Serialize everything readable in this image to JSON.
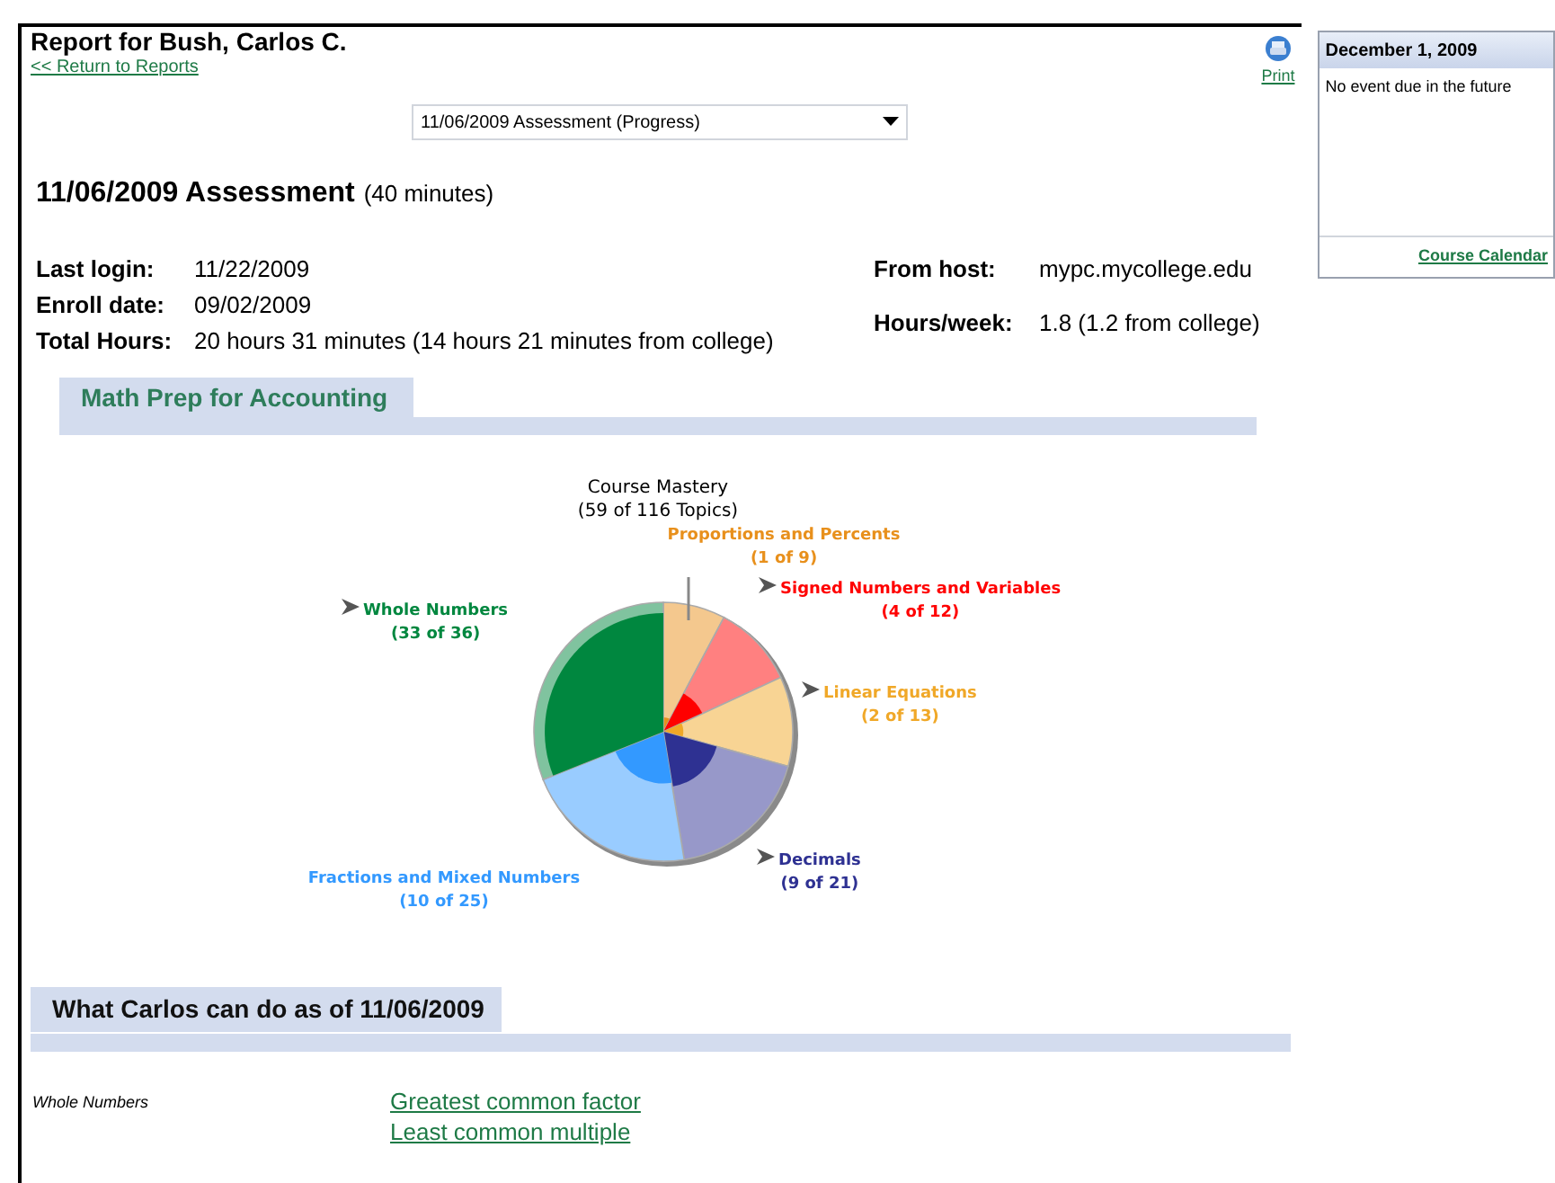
{
  "header": {
    "title": "Report for Bush, Carlos C.",
    "back_link": "<< Return to Reports",
    "print_link": "Print"
  },
  "assessment_select": {
    "value": "11/06/2009 Assessment (Progress)"
  },
  "assessment": {
    "title": "11/06/2009 Assessment",
    "duration": "(40 minutes)"
  },
  "info_left": [
    {
      "label": "Last login:",
      "value": "11/22/2009"
    },
    {
      "label": "Enroll date:",
      "value": "09/02/2009"
    },
    {
      "label": "Total Hours:",
      "value": "20 hours 31 minutes (14 hours 21 minutes from college)"
    }
  ],
  "info_right": [
    {
      "label": "From host:",
      "value": "mypc.mycollege.edu"
    },
    {
      "label": "Hours/week:",
      "value": "1.8 (1.2 from college)"
    }
  ],
  "course_section": {
    "title": "Math Prep for Accounting",
    "mastery_chart": {
      "title": "Course Mastery",
      "subtitle": "(59 of 116 Topics)",
      "topics": [
        {
          "name": "Proportions and Percents",
          "score": "(1 of 9)",
          "color": "#e8901c",
          "pointer": false
        },
        {
          "name": "Signed Numbers and Variables",
          "score": "(4 of 12)",
          "color": "#ff0000",
          "pointer": true
        },
        {
          "name": "Whole Numbers",
          "score": "(33 of 36)",
          "color": "#00873f",
          "pointer": true
        },
        {
          "name": "Linear Equations",
          "score": "(2 of 13)",
          "color": "#f0a828",
          "pointer": true
        },
        {
          "name": "Decimals",
          "score": "(9 of 21)",
          "color": "#2e3192",
          "pointer": true
        },
        {
          "name": "Fractions and Mixed Numbers",
          "score": "(10 of 25)",
          "color": "#3399ff",
          "pointer": false
        }
      ]
    }
  },
  "skills_section": {
    "title": "What Carlos can do as of 11/06/2009",
    "groups": [
      {
        "name": "Whole Numbers",
        "skills": [
          "Greatest common factor",
          "Least common multiple"
        ]
      }
    ]
  },
  "calendar": {
    "date": "December 1, 2009",
    "message": "No event due in the future",
    "link": "Course Calendar"
  }
}
